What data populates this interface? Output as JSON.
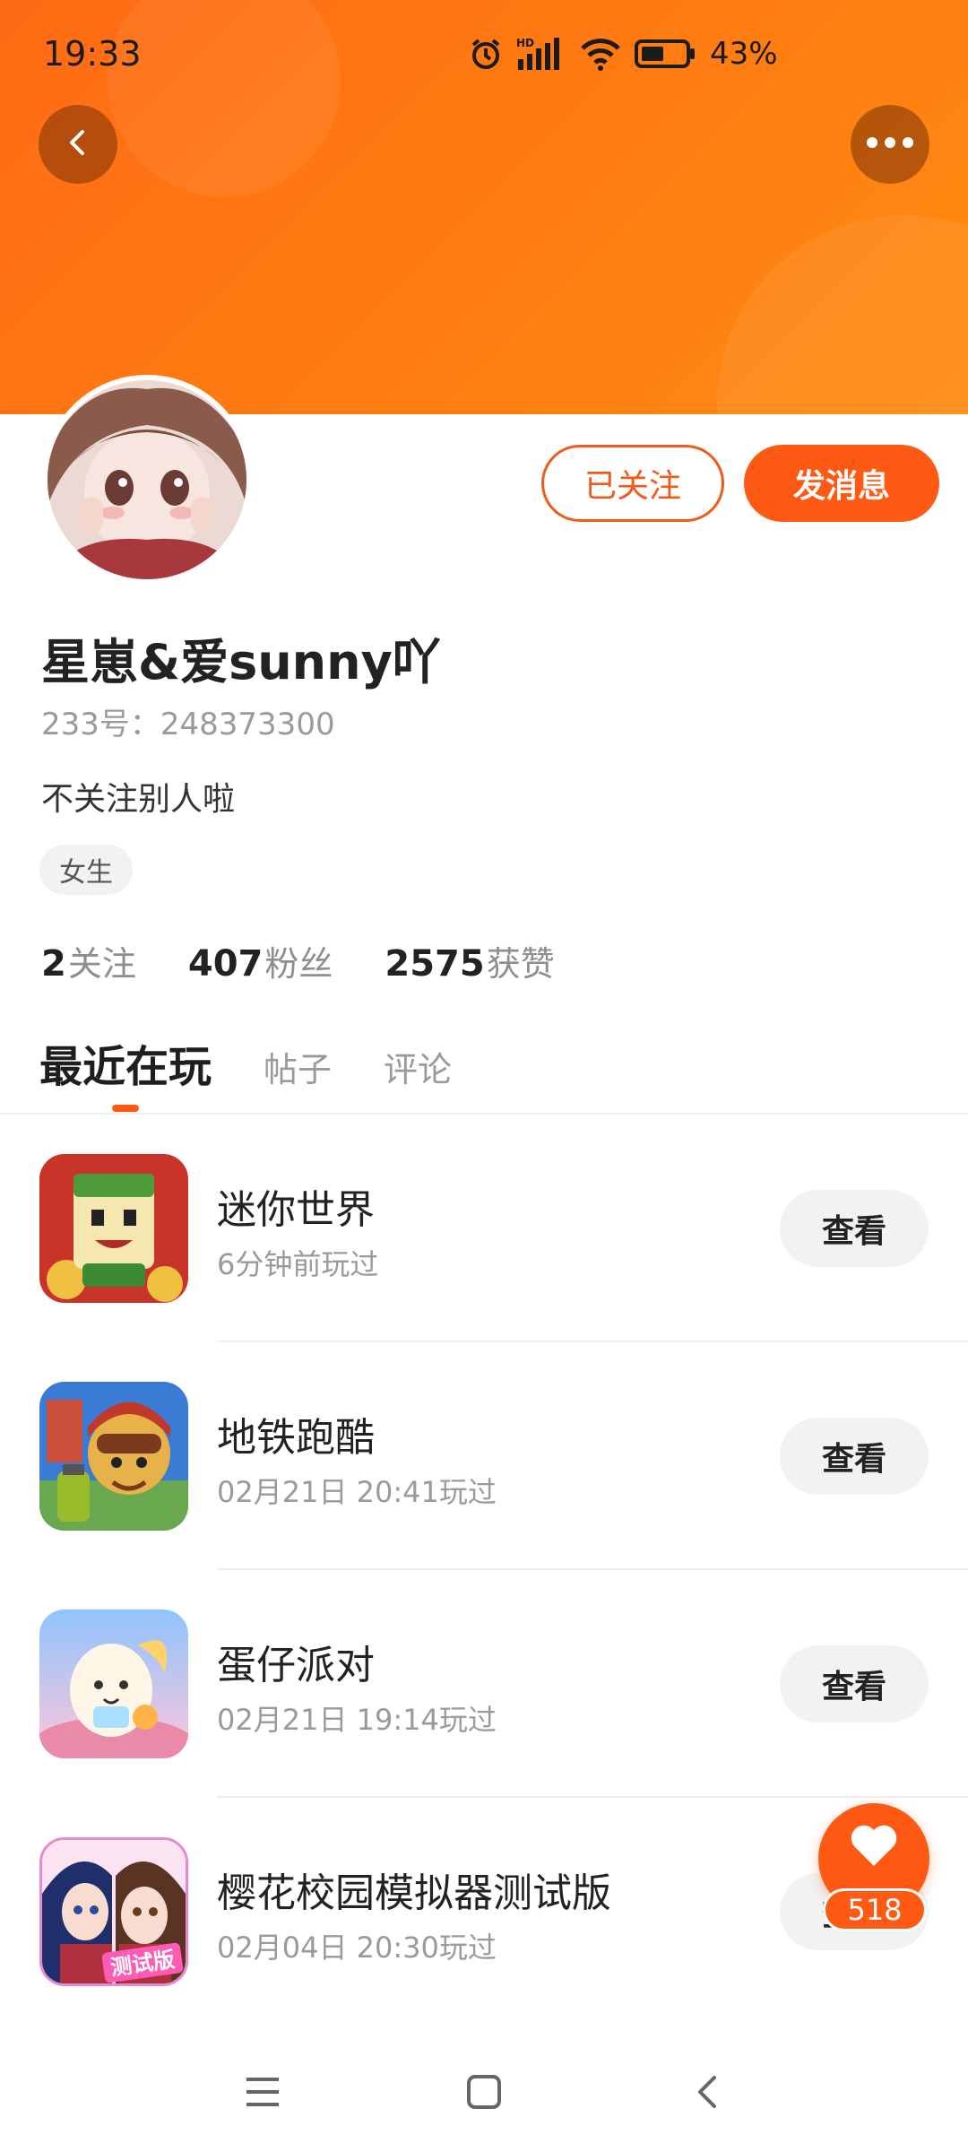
{
  "status_bar": {
    "time": "19:33",
    "battery": "43%",
    "network": "HD"
  },
  "header": {
    "back_icon": "back-arrow-icon",
    "more_icon": "more-dots-icon",
    "accent_color": "#ff6a14"
  },
  "profile": {
    "username": "星崽&爱sunny吖",
    "user_id": "233号：248373300",
    "bio": "不关注别人啦",
    "gender_tag": "女生",
    "followed_label": "已关注",
    "message_label": "发消息",
    "stats": [
      {
        "value": "2",
        "label": "关注"
      },
      {
        "value": "407",
        "label": "粉丝"
      },
      {
        "value": "2575",
        "label": "获赞"
      }
    ]
  },
  "tabs": [
    {
      "label": "最近在玩",
      "active": true
    },
    {
      "label": "帖子",
      "active": false
    },
    {
      "label": "评论",
      "active": false
    }
  ],
  "games": [
    {
      "name": "迷你世界",
      "played": "6分钟前玩过",
      "button": "查看",
      "icon_colors": [
        "#c23a20",
        "#f0c040"
      ]
    },
    {
      "name": "地铁跑酷",
      "played": "02月21日 20:41玩过",
      "button": "查看",
      "icon_colors": [
        "#3a7bd5",
        "#e8b24a"
      ]
    },
    {
      "name": "蛋仔派对",
      "played": "02月21日 19:14玩过",
      "button": "查看",
      "icon_colors": [
        "#8fc4ff",
        "#ffc6d9"
      ]
    },
    {
      "name": "樱花校园模拟器测试版",
      "played": "02月04日 20:30玩过",
      "button": "查看",
      "icon_colors": [
        "#f7c8e8",
        "#a83a8a"
      ],
      "icon_text": "测试版"
    }
  ],
  "fab": {
    "like_count": "518",
    "icon": "heart-icon"
  },
  "nav_bar": {
    "menu_icon": "menu-icon",
    "home_icon": "home-square-icon",
    "back_icon": "nav-back-icon"
  }
}
